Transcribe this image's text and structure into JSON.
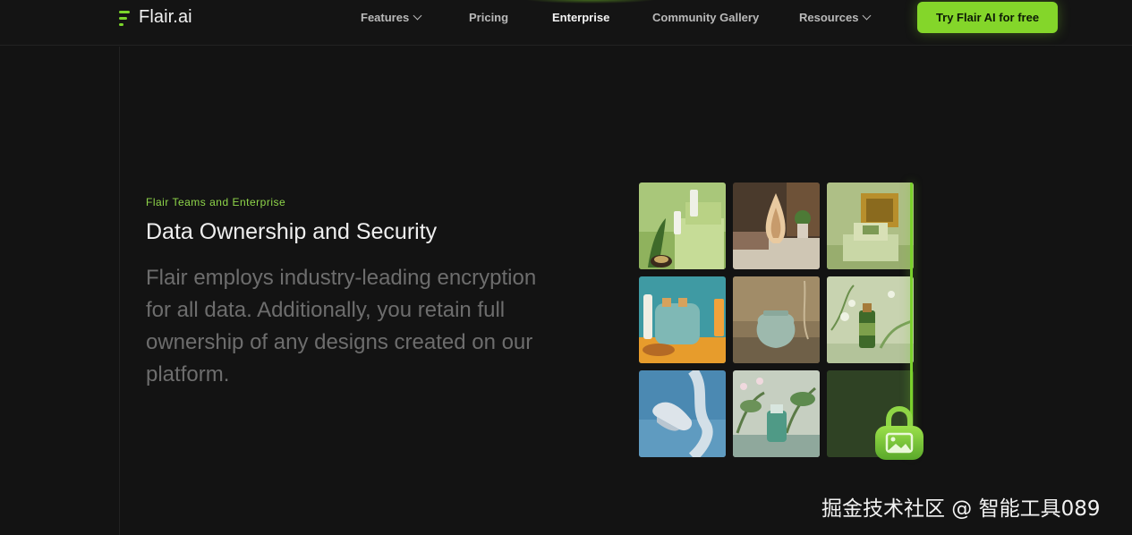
{
  "nav": {
    "logo_text": "Flair.ai",
    "links": [
      {
        "label": "Features",
        "has_dropdown": true
      },
      {
        "label": "Pricing",
        "has_dropdown": false
      },
      {
        "label": "Enterprise",
        "has_dropdown": false,
        "active": true
      },
      {
        "label": "Community Gallery",
        "has_dropdown": false
      },
      {
        "label": "Resources",
        "has_dropdown": true
      }
    ],
    "cta_label": "Try Flair AI  for free"
  },
  "hero": {
    "eyebrow": "Flair Teams and Enterprise",
    "title": "Data Ownership and Security",
    "body": "Flair employs industry-leading encryption for all data. Additionally, you retain full ownership of any designs created on our platform."
  },
  "gallery": {
    "tiles": [
      "skincare-bottles-on-green-steps",
      "wooden-sculpture-with-plant",
      "gold-box-on-pedestal",
      "blue-toaster-with-juice",
      "ceramic-jar-on-stone",
      "green-bottle-with-flowers",
      "sneaker-with-fabric",
      "product-among-plants",
      "empty-green-tile"
    ],
    "lock_icon": "lock-image-icon"
  },
  "colors": {
    "accent": "#84d62a",
    "background": "#131313",
    "eyebrow": "#8fd64a",
    "body_text": "#6d6d6d"
  },
  "watermark": "掘金技术社区 @ 智能工具089"
}
